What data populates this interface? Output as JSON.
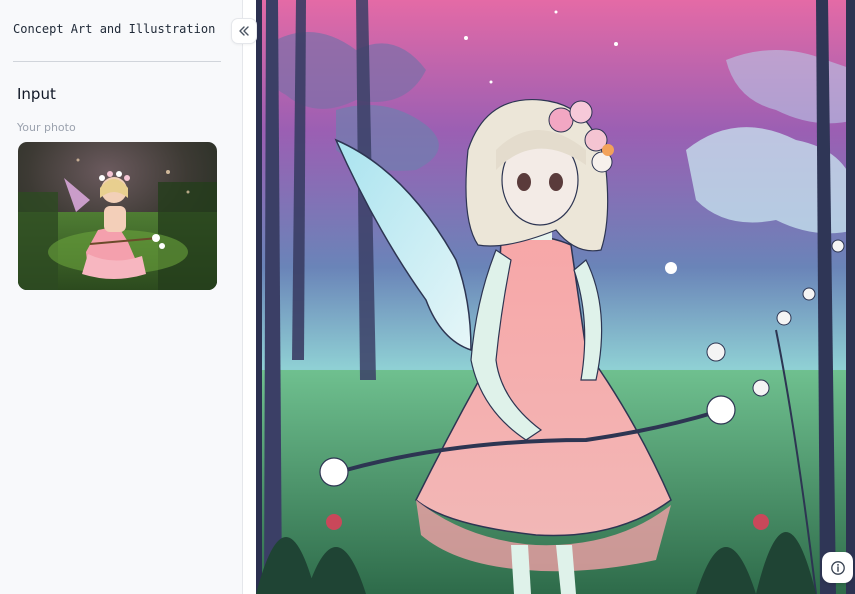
{
  "sidebar": {
    "app_title": "Concept Art and Illustration",
    "input_heading": "Input",
    "photo_label": "Your photo"
  },
  "icons": {
    "collapse": "double-chevron-left-icon",
    "info": "info-icon"
  }
}
